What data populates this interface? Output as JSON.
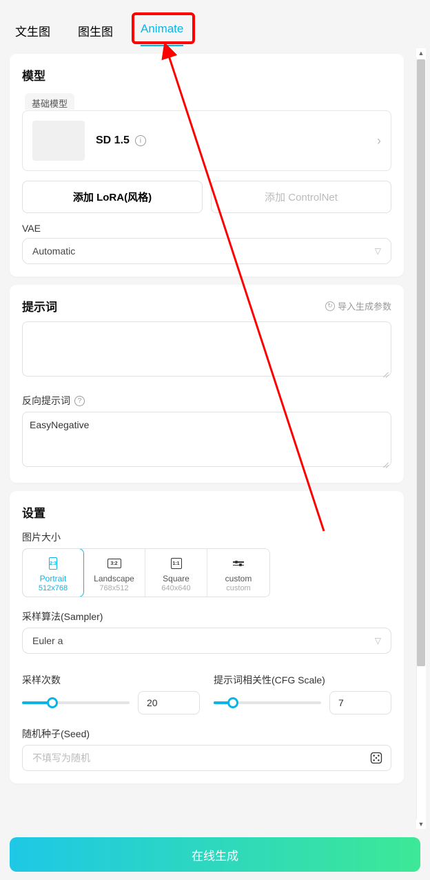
{
  "tabs": {
    "txt2img": "文生图",
    "img2img": "图生图",
    "animate": "Animate"
  },
  "model": {
    "section": "模型",
    "base_label": "基础模型",
    "name": "SD 1.5",
    "add_lora": "添加 LoRA(风格)",
    "add_controlnet": "添加 ControlNet",
    "vae_label": "VAE",
    "vae_value": "Automatic"
  },
  "prompt": {
    "section": "提示词",
    "import": "导入生成参数",
    "neg_label": "反向提示词",
    "neg_value": "EasyNegative"
  },
  "settings": {
    "section": "设置",
    "size_label": "图片大小",
    "sizes": [
      {
        "ratio": "2:3",
        "name": "Portrait",
        "dim": "512x768",
        "w": 12,
        "h": 18,
        "active": true
      },
      {
        "ratio": "3:2",
        "name": "Landscape",
        "dim": "768x512",
        "w": 20,
        "h": 14,
        "active": false
      },
      {
        "ratio": "1:1",
        "name": "Square",
        "dim": "640x640",
        "w": 16,
        "h": 16,
        "active": false
      },
      {
        "ratio": "",
        "name": "custom",
        "dim": "custom",
        "custom": true,
        "active": false
      }
    ],
    "sampler_label": "采样算法(Sampler)",
    "sampler_value": "Euler a",
    "steps_label": "采样次数",
    "steps_value": "20",
    "steps_percent": 28,
    "cfg_label": "提示词相关性(CFG Scale)",
    "cfg_value": "7",
    "cfg_percent": 18,
    "seed_label": "随机种子(Seed)",
    "seed_placeholder": "不填写为随机"
  },
  "generate": "在线生成"
}
